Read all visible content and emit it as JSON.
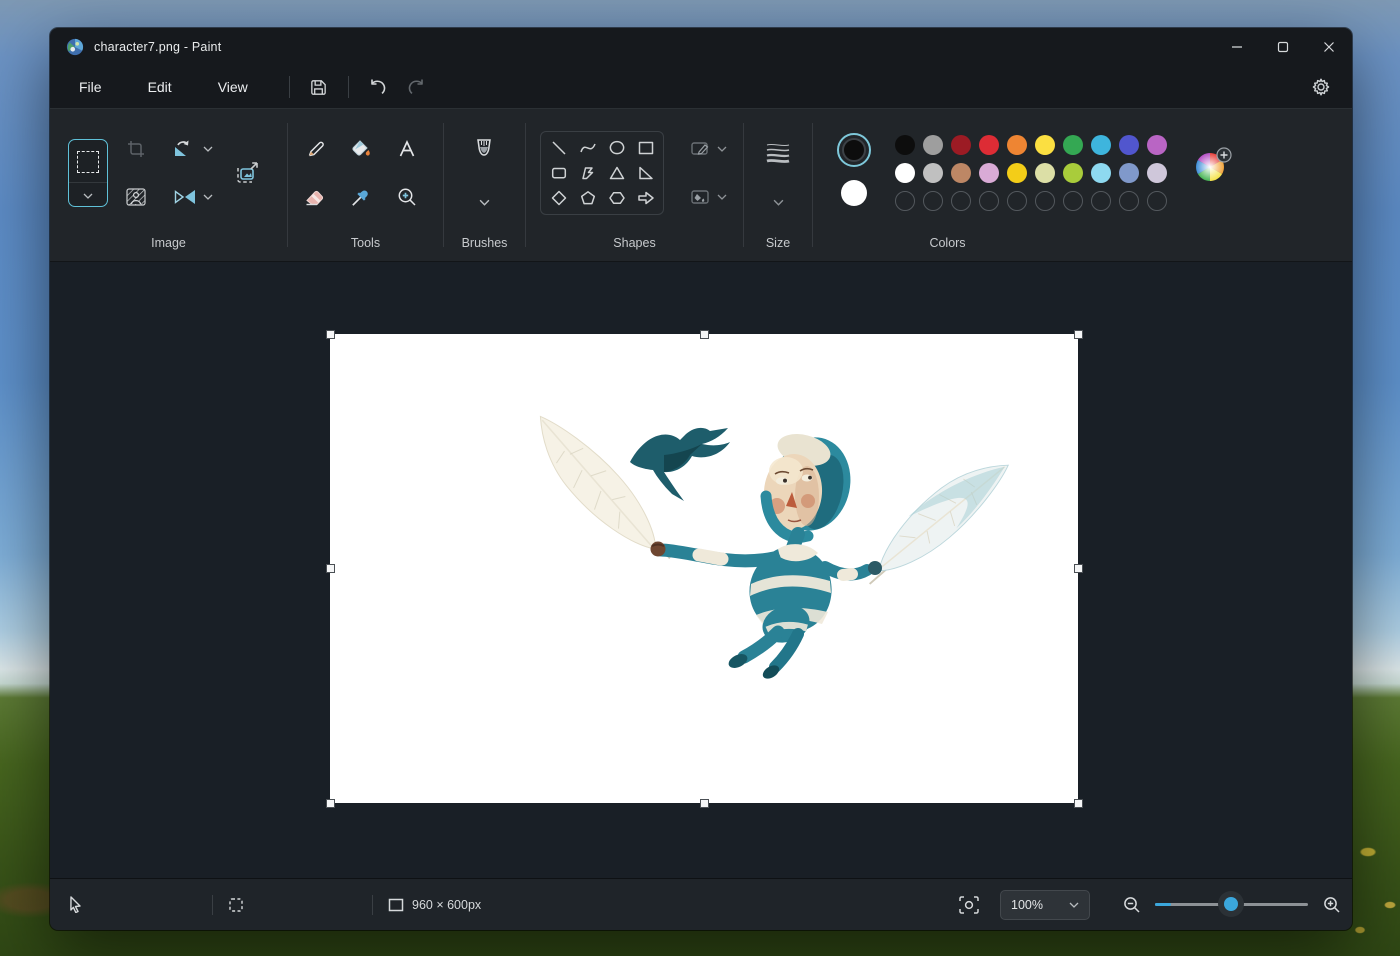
{
  "window": {
    "title": "character7.png - Paint",
    "controls": {
      "minimize": "minimize",
      "maximize": "maximize",
      "close": "close"
    }
  },
  "menubar": {
    "items": [
      "File",
      "Edit",
      "View"
    ],
    "icons": [
      "save-icon",
      "undo-icon",
      "redo-icon",
      "settings-gear-icon"
    ]
  },
  "ribbon": {
    "group_labels": {
      "image": "Image",
      "tools": "Tools",
      "brushes": "Brushes",
      "shapes": "Shapes",
      "size": "Size",
      "colors": "Colors"
    },
    "image_tools": [
      "rectangle-select",
      "crop",
      "rotate",
      "remove-background",
      "flip",
      "resize"
    ],
    "tool_icons": [
      "pencil",
      "fill-bucket",
      "text",
      "eraser",
      "color-picker",
      "magnifier"
    ],
    "shape_names": [
      "line",
      "curve",
      "oval",
      "rectangle",
      "rounded-rectangle",
      "polygon",
      "triangle",
      "right-triangle",
      "diamond",
      "pentagon",
      "hexagon",
      "arrow-right"
    ]
  },
  "colors": {
    "color1": "#0d0d0d",
    "color2": "#ffffff",
    "palette_row1": [
      "#0d0d0d",
      "#9e9e9e",
      "#9c1b24",
      "#dd2c35",
      "#ee8533",
      "#fbdf41",
      "#34a853",
      "#3eb5dd",
      "#5156ce",
      "#b965c4"
    ],
    "palette_row2": [
      "#ffffff",
      "#c0c0c0",
      "#bd8765",
      "#d9abd6",
      "#f3cd18",
      "#dcdfa6",
      "#a9cc3b",
      "#8ed9f0",
      "#8099cb",
      "#cfc7da"
    ],
    "empty_slots": 10,
    "selected": "color1"
  },
  "statusbar": {
    "canvas_size": "960 × 600px",
    "zoom_value": "100%"
  },
  "canvas": {
    "artwork_subject": "fairy character in teal and white striped suit flying while holding two large feathers, with a small teal bird"
  }
}
